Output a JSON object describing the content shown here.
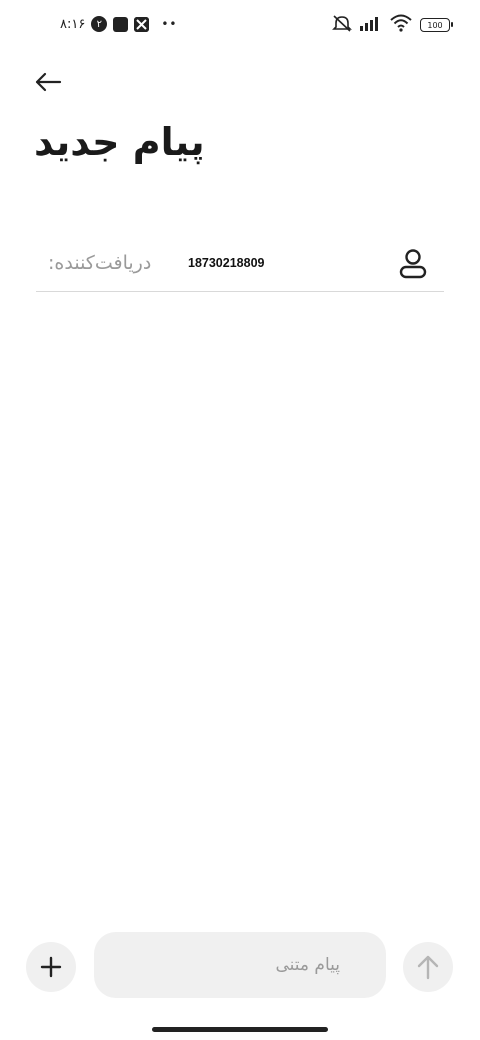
{
  "status_bar": {
    "time": "۸:۱۶",
    "notification_badge": "۲",
    "dots": "••",
    "battery_level": "100"
  },
  "header": {
    "title": "پیام جدید"
  },
  "recipient": {
    "label": "دریافت‌کننده:",
    "number": "18730218809"
  },
  "composer": {
    "placeholder": "پیام متنی"
  },
  "icons": {
    "back": "arrow-left-icon",
    "contact": "person-icon",
    "add": "plus-icon",
    "send": "arrow-up-icon"
  }
}
